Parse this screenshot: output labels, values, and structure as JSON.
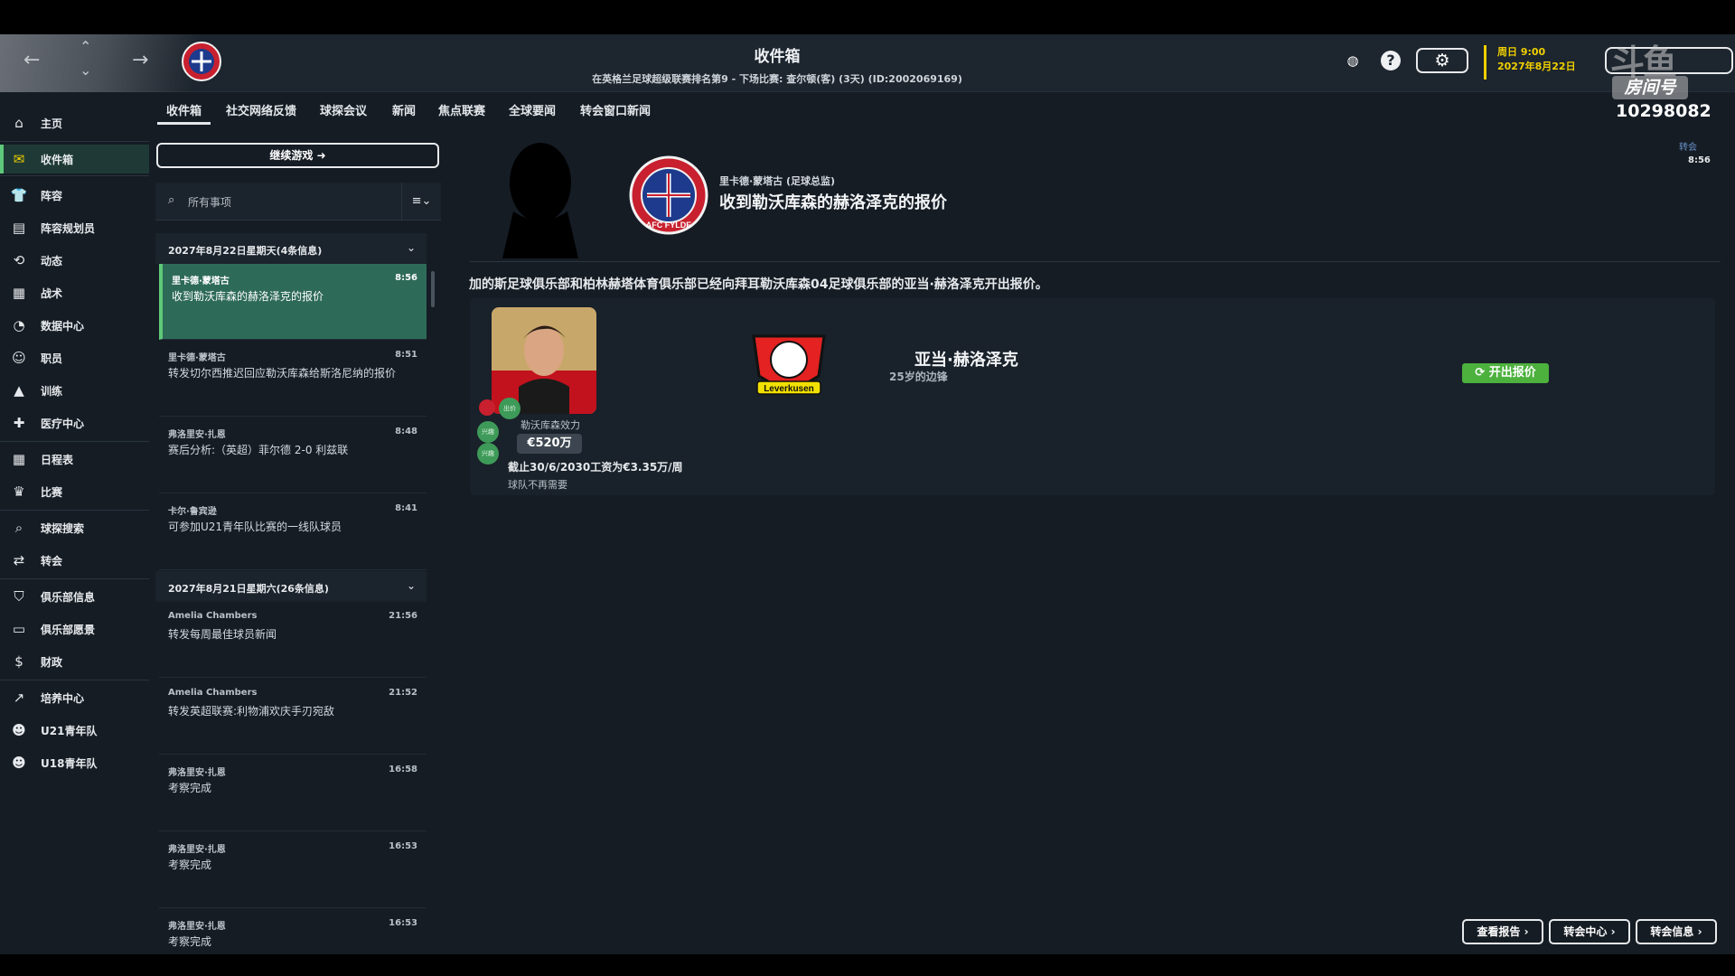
{
  "header": {
    "title": "收件箱",
    "subtitle": "在英格兰足球超级联赛排名第9 - 下场比赛: 查尔顿(客) (3天) (ID:2002069169)",
    "date_line1": "周日 9:00",
    "date_line2": "2027年8月22日",
    "help_icon": "?",
    "watermark_logo": "斗鱼",
    "watermark_room_label": "房间号",
    "watermark_room_number": "10298082"
  },
  "tabs": [
    "收件箱",
    "社交网络反馈",
    "球探会议",
    "新闻",
    "焦点联赛",
    "全球要闻",
    "转会窗口新闻"
  ],
  "sidebar": [
    {
      "label": "主页",
      "icon": "home-icon",
      "glyph": "⌂"
    },
    {
      "label": "收件箱",
      "icon": "inbox-icon",
      "glyph": "✉",
      "active": true
    },
    {
      "label": "阵容",
      "icon": "shirt-icon",
      "glyph": "👕"
    },
    {
      "label": "阵容规划员",
      "icon": "clipboard-icon",
      "glyph": "▤"
    },
    {
      "label": "动态",
      "icon": "dynamics-icon",
      "glyph": "⟲"
    },
    {
      "label": "战术",
      "icon": "tactics-icon",
      "glyph": "▦"
    },
    {
      "label": "数据中心",
      "icon": "data-hub-icon",
      "glyph": "◔"
    },
    {
      "label": "职员",
      "icon": "staff-icon",
      "glyph": "☺"
    },
    {
      "label": "训练",
      "icon": "training-icon",
      "glyph": "▲"
    },
    {
      "label": "医疗中心",
      "icon": "medical-icon",
      "glyph": "✚"
    },
    {
      "label": "日程表",
      "icon": "calendar-icon",
      "glyph": "▦"
    },
    {
      "label": "比赛",
      "icon": "trophy-icon",
      "glyph": "♛"
    },
    {
      "label": "球探搜索",
      "icon": "scout-search-icon",
      "glyph": "⌕"
    },
    {
      "label": "转会",
      "icon": "transfer-icon",
      "glyph": "⇄"
    },
    {
      "label": "俱乐部信息",
      "icon": "club-shield-icon",
      "glyph": "⛉"
    },
    {
      "label": "俱乐部愿景",
      "icon": "vision-icon",
      "glyph": "▭"
    },
    {
      "label": "财政",
      "icon": "finance-icon",
      "glyph": "$"
    },
    {
      "label": "培养中心",
      "icon": "development-icon",
      "glyph": "↗"
    },
    {
      "label": "U21青年队",
      "icon": "u21-icon",
      "glyph": "☻"
    },
    {
      "label": "U18青年队",
      "icon": "u18-icon",
      "glyph": "☻"
    }
  ],
  "list": {
    "continue_label": "继续游戏",
    "search_placeholder": "所有事项",
    "groups": [
      {
        "header": "2027年8月22日星期天(4条信息)",
        "messages": [
          {
            "from": "里卡德·蒙塔古",
            "time": "8:56",
            "subject": "收到勒沃库森的赫洛泽克的报价",
            "selected": true
          },
          {
            "from": "里卡德·蒙塔古",
            "time": "8:51",
            "subject": "转发切尔西推迟回应勒沃库森给斯洛尼纳的报价"
          },
          {
            "from": "弗洛里安·扎恩",
            "time": "8:48",
            "subject": "赛后分析:（英超）菲尔德 2-0 利兹联"
          },
          {
            "from": "卡尔·鲁宾逊",
            "time": "8:41",
            "subject": "可参加U21青年队比赛的一线队球员"
          }
        ]
      },
      {
        "header": "2027年8月21日星期六(26条信息)",
        "messages": [
          {
            "from": "Amelia Chambers",
            "time": "21:56",
            "subject": "转发每周最佳球员新闻"
          },
          {
            "from": "Amelia Chambers",
            "time": "21:52",
            "subject": "转发英超联赛:利物浦欢庆手刃宛敌"
          },
          {
            "from": "弗洛里安·扎恩",
            "time": "16:58",
            "subject": "考察完成"
          },
          {
            "from": "弗洛里安·扎恩",
            "time": "16:53",
            "subject": "考察完成"
          },
          {
            "from": "弗洛里安·扎恩",
            "time": "16:53",
            "subject": "考察完成"
          }
        ]
      }
    ]
  },
  "detail": {
    "sender": "里卡德·蒙塔古 (足球总监)",
    "headline": "收到勒沃库森的赫洛泽克的报价",
    "tag": "转会",
    "time": "8:56",
    "body": "加的斯足球俱乐部和柏林赫塔体育俱乐部已经向拜耳勒沃库森04足球俱乐部的亚当·赫洛泽克开出报价。",
    "club_badge_text": "AFC FYLDE",
    "player": {
      "name": "亚当·赫洛泽克",
      "desc": "25岁的边锋",
      "plays_for": "勒沃库森效力",
      "value": "€520万",
      "contract": "截止30/6/2030工资为€3.35万/周",
      "status": "球队不再需要",
      "offer_label": "开出报价",
      "club_badge_text": "Leverkusen",
      "badges": [
        "出价",
        "兴趣",
        "兴趣"
      ]
    }
  },
  "footer": {
    "report_label": "查看报告",
    "transfer_center_label": "转会中心",
    "transfer_info_label": "转会信息"
  },
  "colors": {
    "accent_green": "#4db13e",
    "date_yellow": "#f0d000",
    "selected_bg": "#2e6a58",
    "panel_bg": "#151c24"
  }
}
